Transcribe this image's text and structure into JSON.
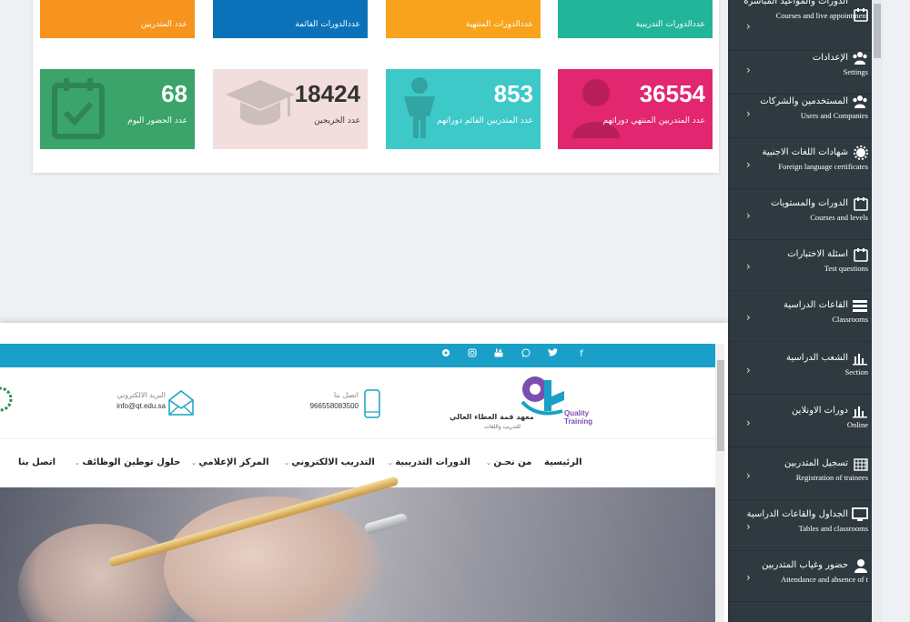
{
  "dashboard": {
    "top_cards": [
      {
        "label": "عدد المتدربين",
        "color": "#f7941d"
      },
      {
        "label": "عددالدورات القائمة",
        "color": "#0b72b9"
      },
      {
        "label": "عددالدورات المنتهية",
        "color": "#f8a31b"
      },
      {
        "label": "عددالدورات التدريبية",
        "color": "#22b59a"
      }
    ],
    "bottom_cards": [
      {
        "value": "68",
        "label": "عدد الحضور اليوم",
        "color": "#3aa46a",
        "icon": "calendar-check-icon"
      },
      {
        "value": "18424",
        "label": "عدد الخريجين",
        "color": "#f3dede",
        "icon": "graduation-cap-icon"
      },
      {
        "value": "853",
        "label": "عدد المتدربين القائم دوراتهم",
        "color": "#3ec9c9",
        "icon": "person-icon"
      },
      {
        "value": "36554",
        "label": "عدد المتدربين المنتهي دوراتهم",
        "color": "#e2266f",
        "icon": "user-icon"
      }
    ]
  },
  "sidebar": {
    "items": [
      {
        "ar": "الدورات والمواعيد المباشرة",
        "en": "Courses and live appointment",
        "icon": "calendar-icon"
      },
      {
        "ar": "الإعدادات",
        "en": "Settings",
        "icon": "users-icon"
      },
      {
        "ar": "المستخدمين والشركات",
        "en": "Users and Companies",
        "icon": "users-icon"
      },
      {
        "ar": "شهادات اللغات الاجنبية",
        "en": "Foreign language certificates",
        "icon": "gear-icon"
      },
      {
        "ar": "الدورات والمستويات",
        "en": "Courses and levels",
        "icon": "calendar-icon"
      },
      {
        "ar": "اسئلة الاختبارات",
        "en": "Test questions",
        "icon": "calendar-icon"
      },
      {
        "ar": "القاعات الدراسية",
        "en": "Classrooms",
        "icon": "list-icon"
      },
      {
        "ar": "الشعب الدراسية",
        "en": "Section",
        "icon": "bar-chart-icon"
      },
      {
        "ar": "دورات الاونلاين",
        "en": "Online",
        "icon": "bar-chart-icon"
      },
      {
        "ar": "تسجيل المتدربين",
        "en": "Registration of trainees",
        "icon": "calendar-grid-icon"
      },
      {
        "ar": "الجداول والقاعات الدراسية",
        "en": "Tables and classrooms",
        "icon": "monitor-icon"
      },
      {
        "ar": "حضور وغياب المتدربين",
        "en": "Attendance and absence of t",
        "icon": "user-icon"
      }
    ]
  },
  "website": {
    "logo": {
      "name_ar": "معهد قمة العطاء العالي",
      "sub_ar": "للتدريب واللغات",
      "brand_line1": "Quality",
      "brand_line2": "Training",
      "colors": {
        "purple": "#7a4fb0",
        "teal": "#1aa0c8"
      }
    },
    "phone": {
      "title": "اتصل بنا",
      "value": "966558083500"
    },
    "email": {
      "title": "البريد الالكتروني",
      "value": "info@qt.edu.sa"
    },
    "nav": [
      {
        "label": "الرئيسية"
      },
      {
        "label": "من نحـن"
      },
      {
        "label": "الدورات التدريبية"
      },
      {
        "label": "التدريب الالكتروني"
      },
      {
        "label": "المركز الإعلامي"
      },
      {
        "label": "حلول توطين الوظائف"
      },
      {
        "label": "اتصل بنا"
      }
    ],
    "social": [
      "facebook-icon",
      "twitter-icon",
      "whatsapp-icon",
      "youtube-icon",
      "instagram-icon",
      "snapchat-icon"
    ]
  }
}
